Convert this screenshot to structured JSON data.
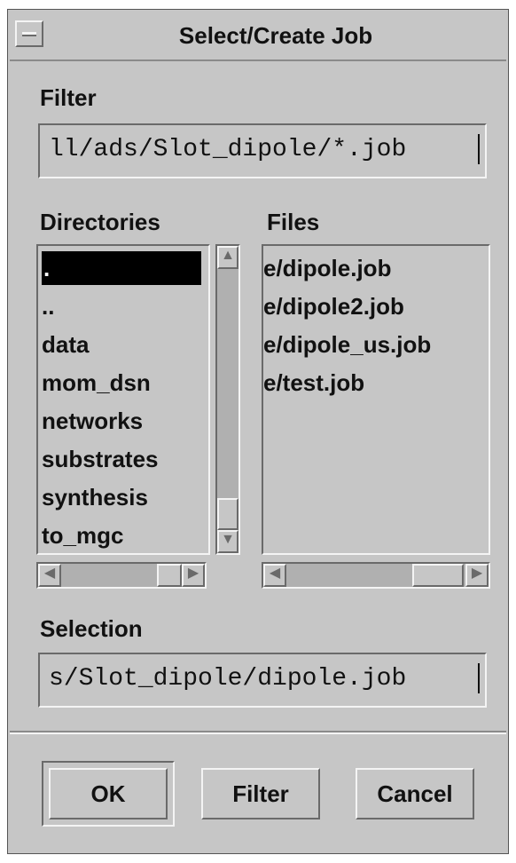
{
  "window": {
    "title": "Select/Create Job"
  },
  "filter": {
    "label": "Filter",
    "value": "ll/ads/Slot_dipole/*.job"
  },
  "directories": {
    "label": "Directories",
    "selected_index": 0,
    "items": [
      ".",
      "..",
      "data",
      "mom_dsn",
      "networks",
      "substrates",
      "synthesis",
      "to_mgc"
    ]
  },
  "files": {
    "label": "Files",
    "items": [
      "e/dipole.job",
      "e/dipole2.job",
      "e/dipole_us.job",
      "e/test.job"
    ]
  },
  "selection": {
    "label": "Selection",
    "value": "s/Slot_dipole/dipole.job"
  },
  "buttons": {
    "ok": "OK",
    "filter": "Filter",
    "cancel": "Cancel"
  },
  "icons": {
    "window_menu": "window-menu-icon",
    "scroll_up": "arrow-up-icon",
    "scroll_down": "arrow-down-icon",
    "scroll_left": "arrow-left-icon",
    "scroll_right": "arrow-right-icon"
  }
}
